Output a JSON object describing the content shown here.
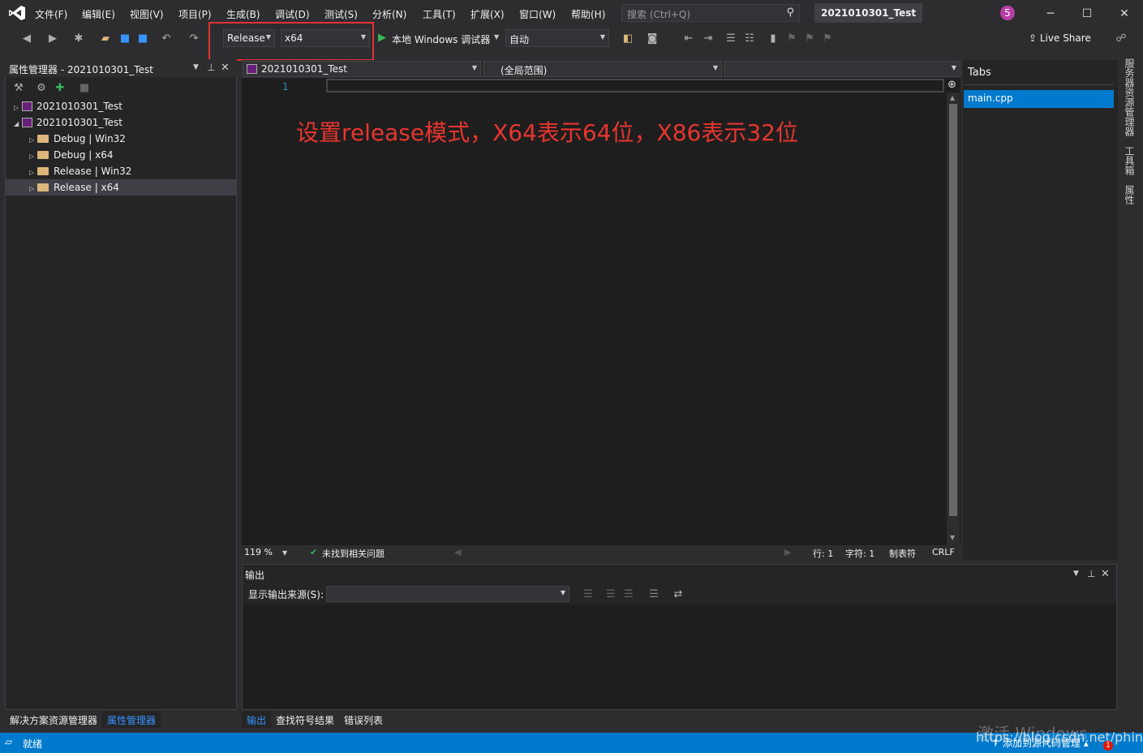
{
  "menu": {
    "items": [
      "文件(F)",
      "编辑(E)",
      "视图(V)",
      "项目(P)",
      "生成(B)",
      "调试(D)",
      "测试(S)",
      "分析(N)",
      "工具(T)",
      "扩展(X)",
      "窗口(W)",
      "帮助(H)"
    ],
    "search_placeholder": "搜索 (Ctrl+Q)",
    "solution_title": "2021010301_Test",
    "user_badge": "5"
  },
  "toolbar": {
    "configuration": "Release",
    "platform": "x64",
    "debugger": "本地 Windows 调试器",
    "debugger_mode": "自动",
    "live_share": "Live Share"
  },
  "property_manager": {
    "title": "属性管理器 - 2021010301_Test",
    "tree": [
      {
        "label": "2021010301_Test",
        "type": "project",
        "expanded": false
      },
      {
        "label": "2021010301_Test",
        "type": "project",
        "expanded": true
      },
      {
        "label": "Debug | Win32",
        "type": "folder"
      },
      {
        "label": "Debug | x64",
        "type": "folder"
      },
      {
        "label": "Release | Win32",
        "type": "folder"
      },
      {
        "label": "Release | x64",
        "type": "folder",
        "selected": true
      }
    ],
    "bottom_tabs": [
      "解决方案资源管理器",
      "属性管理器"
    ]
  },
  "editor": {
    "project_combo": "2021010301_Test",
    "scope_combo": "(全局范围)",
    "line_number": "1",
    "annotation": "设置release模式，X64表示64位，X86表示32位",
    "zoom": "119 %",
    "issues": "未找到相关问题",
    "line": "行: 1",
    "char": "字符: 1",
    "tabs_mode": "制表符",
    "eol": "CRLF"
  },
  "tabs_panel": {
    "heading": "Tabs",
    "items": [
      "main.cpp"
    ]
  },
  "right_strip": [
    "服务器资源管理器",
    "工具箱",
    "属性"
  ],
  "output": {
    "title": "输出",
    "source_label": "显示输出来源(S):",
    "bottom_tabs": [
      "输出",
      "查找符号结果",
      "错误列表"
    ]
  },
  "status": {
    "text": "就绪",
    "right": "添加到源代码管理",
    "notifications": "1",
    "watermark_activate": "激活 Windows",
    "watermark_url": "https://blog.csdn.net/phinoo"
  },
  "colors": {
    "accent": "#007acc",
    "highlight_box": "#e03333",
    "annotation": "#e8352f"
  }
}
